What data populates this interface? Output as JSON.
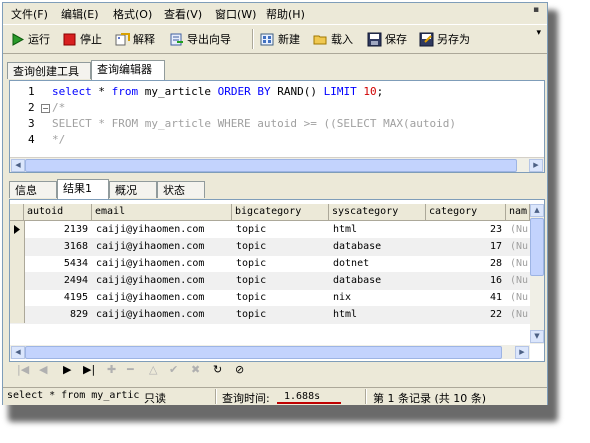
{
  "menu": [
    "文件(F)",
    "编辑(E)",
    "格式(O)",
    "查看(V)",
    "窗口(W)",
    "帮助(H)"
  ],
  "toolbar": {
    "run": "运行",
    "stop": "停止",
    "explain": "解释",
    "export": "导出向导",
    "new": "新建",
    "load": "载入",
    "save": "保存",
    "save_as": "另存为"
  },
  "top_tabs": [
    "查询创建工具",
    "查询编辑器"
  ],
  "editor": {
    "line_numbers": [
      "1",
      "2",
      "3",
      "4"
    ],
    "line1": {
      "k1": "select",
      "p1": " * ",
      "k2": "from",
      "p2": " my_article ",
      "k3": "ORDER BY",
      "p3": " RAND() ",
      "k4": "LIMIT",
      "p4": " ",
      "n": "10",
      "end": ";"
    },
    "line2": "/*",
    "line3": "SELECT * FROM my_article WHERE autoid >= ((SELECT MAX(autoid)",
    "line4": "*/"
  },
  "result_tabs": [
    "信息",
    "结果1",
    "概况",
    "状态"
  ],
  "grid": {
    "columns": [
      "autoid",
      "email",
      "bigcategory",
      "syscategory",
      "category",
      "nam"
    ],
    "rows": [
      {
        "autoid": "2139",
        "email": "caiji@yihaomen.com",
        "bigcategory": "topic",
        "syscategory": "html",
        "category": "23",
        "nam": "(Nu"
      },
      {
        "autoid": "3168",
        "email": "caiji@yihaomen.com",
        "bigcategory": "topic",
        "syscategory": "database",
        "category": "17",
        "nam": "(Nu"
      },
      {
        "autoid": "5434",
        "email": "caiji@yihaomen.com",
        "bigcategory": "topic",
        "syscategory": "dotnet",
        "category": "28",
        "nam": "(Nu"
      },
      {
        "autoid": "2494",
        "email": "caiji@yihaomen.com",
        "bigcategory": "topic",
        "syscategory": "database",
        "category": "16",
        "nam": "(Nu"
      },
      {
        "autoid": "4195",
        "email": "caiji@yihaomen.com",
        "bigcategory": "topic",
        "syscategory": "nix",
        "category": "41",
        "nam": "(Nu"
      },
      {
        "autoid": "829",
        "email": "caiji@yihaomen.com",
        "bigcategory": "topic",
        "syscategory": "html",
        "category": "22",
        "nam": "(Nu"
      }
    ]
  },
  "status": {
    "query": "select * from my_artic",
    "readonly": "只读",
    "time_label": "查询时间:",
    "time_value": "1.688s",
    "records": "第 1 条记录 (共 10 条)"
  },
  "colors": {
    "keyword": "#0000ff",
    "comment": "#a0a0a0",
    "number": "#d00000",
    "window": "#ece9d8",
    "highlight": "#c00000"
  }
}
